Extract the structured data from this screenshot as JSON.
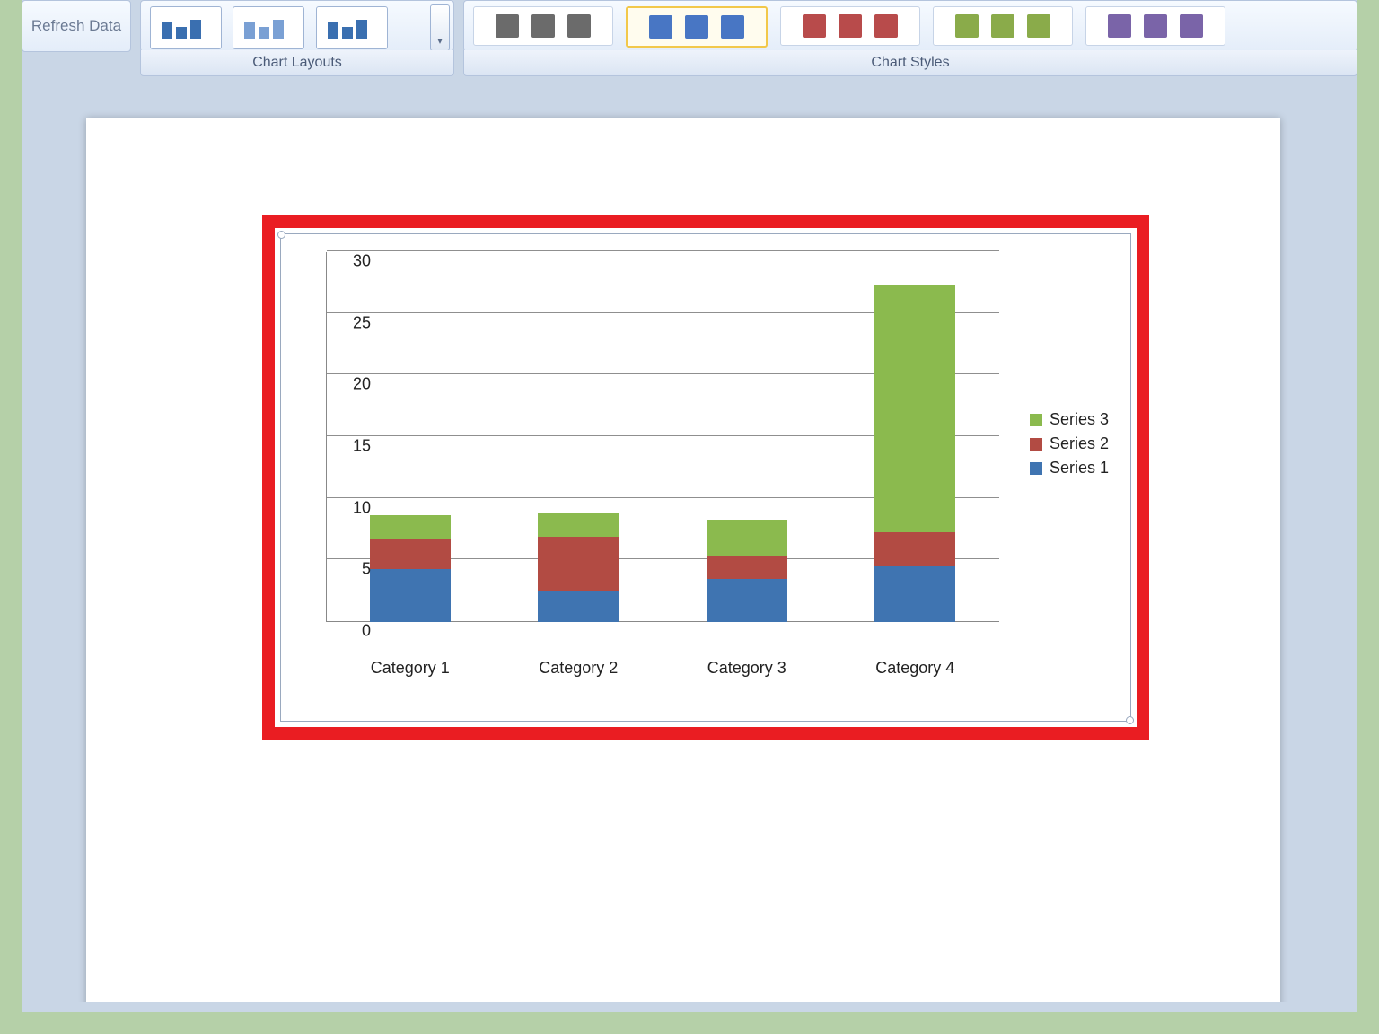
{
  "ribbon": {
    "refresh_label": "Refresh\nData",
    "layouts_label": "Chart Layouts",
    "styles_label": "Chart Styles",
    "style_colors": [
      "#6b6b6b",
      "#4876c4",
      "#b84b4b",
      "#8aab4a",
      "#7a64a8"
    ],
    "selected_style_index": 1
  },
  "chart_data": {
    "type": "bar_stacked",
    "categories": [
      "Category 1",
      "Category 2",
      "Category 3",
      "Category 4"
    ],
    "series": [
      {
        "name": "Series 1",
        "color": "#3f74b1",
        "values": [
          4.3,
          2.5,
          3.5,
          4.5
        ]
      },
      {
        "name": "Series 2",
        "color": "#b24b43",
        "values": [
          2.4,
          4.4,
          1.8,
          2.8
        ]
      },
      {
        "name": "Series 3",
        "color": "#8bba4e",
        "values": [
          2.0,
          2.0,
          3.0,
          20.0
        ]
      }
    ],
    "y_ticks": [
      0,
      5,
      10,
      15,
      20,
      25,
      30
    ],
    "ylim": [
      0,
      30
    ]
  },
  "legend_order": [
    "Series 3",
    "Series 2",
    "Series 1"
  ]
}
